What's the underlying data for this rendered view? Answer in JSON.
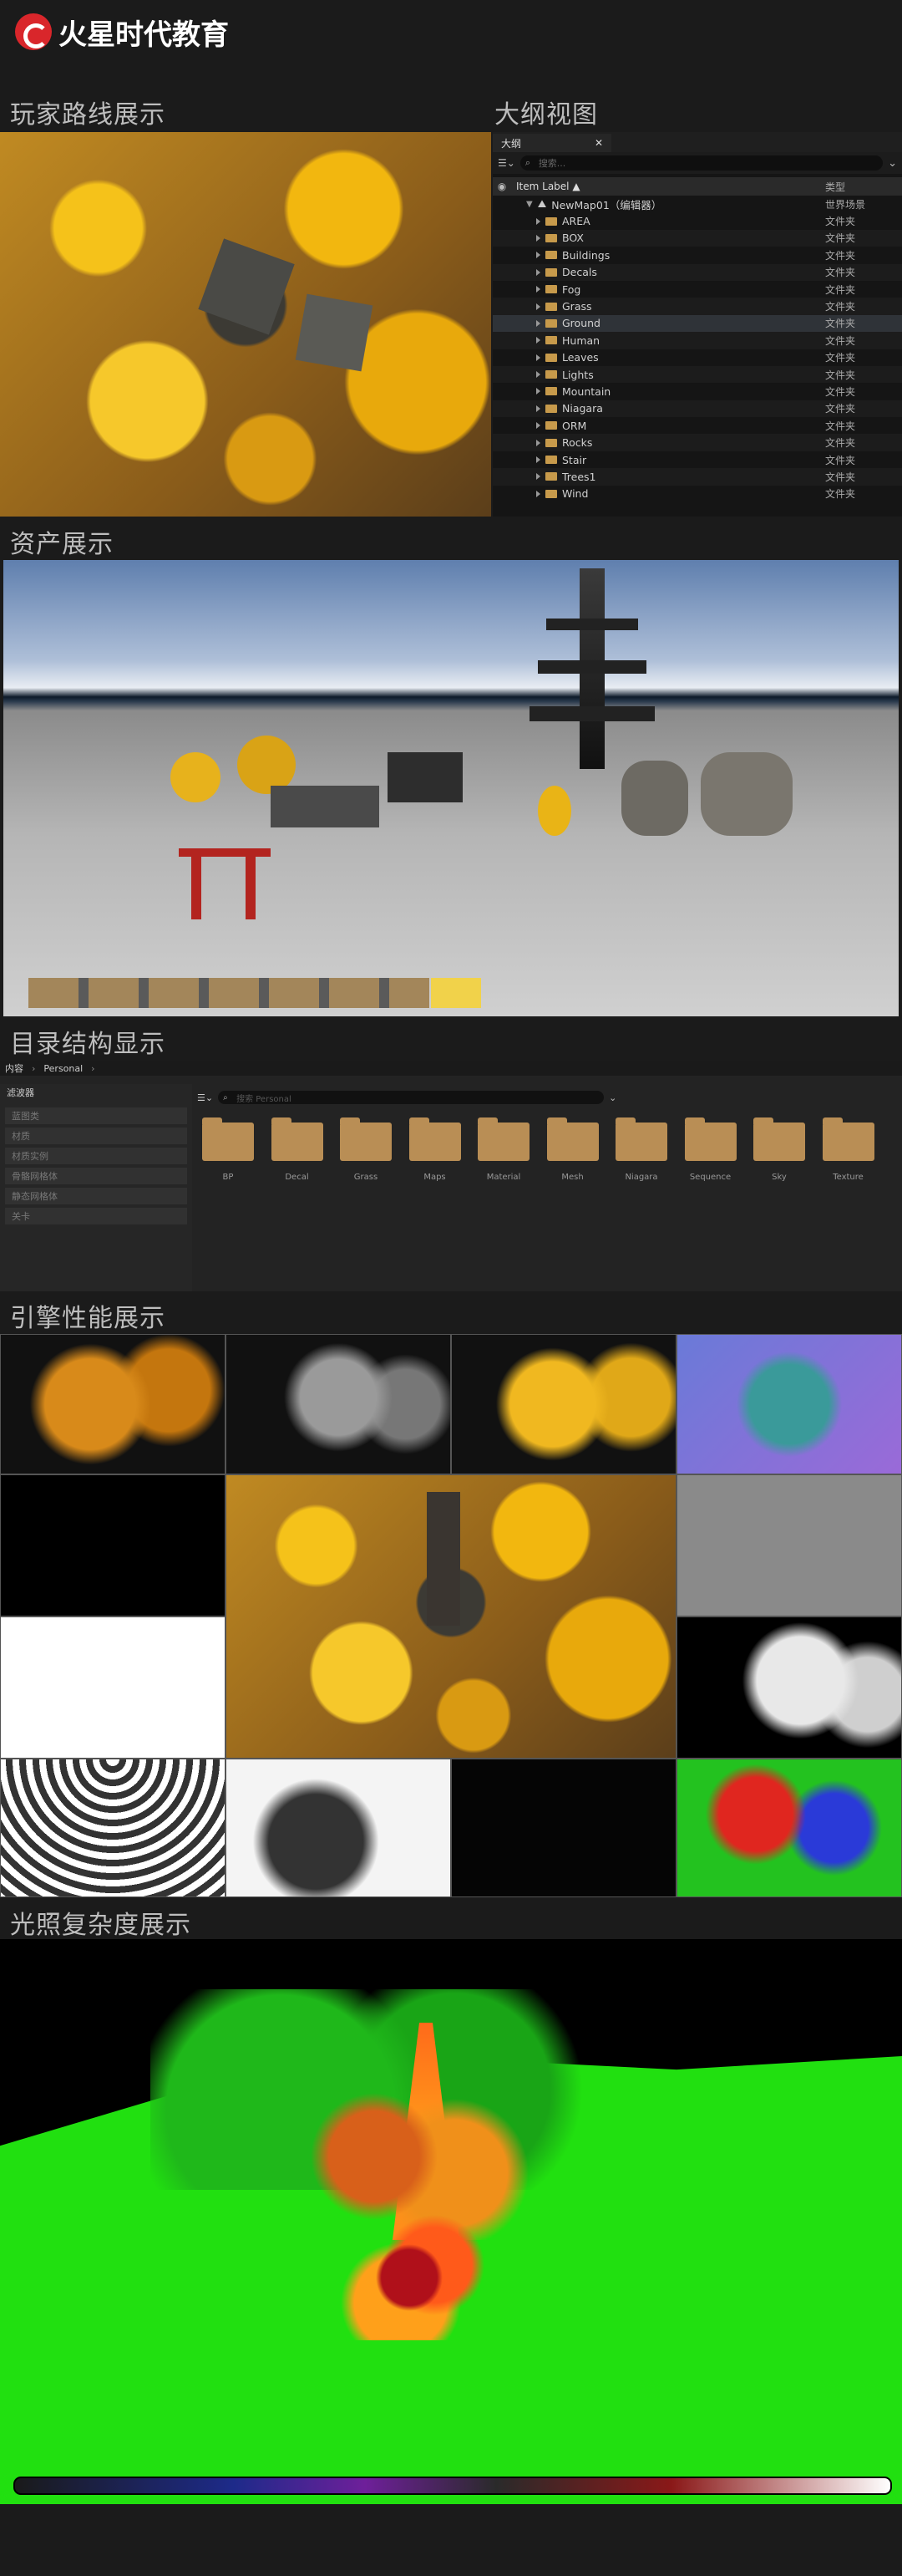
{
  "brand": {
    "name": "火星时代教育",
    "accent": "#d9262b"
  },
  "sections": {
    "route": "玩家路线展示",
    "outline": "大纲视图",
    "assets": "资产展示",
    "directory": "目录结构显示",
    "engine": "引擎性能展示",
    "lighting": "光照复杂度展示"
  },
  "outliner": {
    "tab_label": "大纲",
    "search_placeholder": "搜索...",
    "col_label": "Item Label ▲",
    "col_type": "类型",
    "root": {
      "label": "NewMap01（编辑器）",
      "type": "世界场景"
    },
    "items": [
      {
        "label": "AREA",
        "type": "文件夹"
      },
      {
        "label": "BOX",
        "type": "文件夹"
      },
      {
        "label": "Buildings",
        "type": "文件夹"
      },
      {
        "label": "Decals",
        "type": "文件夹"
      },
      {
        "label": "Fog",
        "type": "文件夹"
      },
      {
        "label": "Grass",
        "type": "文件夹"
      },
      {
        "label": "Ground",
        "type": "文件夹"
      },
      {
        "label": "Human",
        "type": "文件夹"
      },
      {
        "label": "Leaves",
        "type": "文件夹"
      },
      {
        "label": "Lights",
        "type": "文件夹"
      },
      {
        "label": "Mountain",
        "type": "文件夹"
      },
      {
        "label": "Niagara",
        "type": "文件夹"
      },
      {
        "label": "ORM",
        "type": "文件夹"
      },
      {
        "label": "Rocks",
        "type": "文件夹"
      },
      {
        "label": "Stair",
        "type": "文件夹"
      },
      {
        "label": "Trees1",
        "type": "文件夹"
      },
      {
        "label": "Wind",
        "type": "文件夹"
      }
    ]
  },
  "content_browser": {
    "path": [
      "内容",
      "Personal"
    ],
    "filters_title": "滤波器",
    "filters": [
      "蓝图类",
      "材质",
      "材质实例",
      "骨骼网格体",
      "静态网格体",
      "关卡"
    ],
    "search_placeholder": "搜索 Personal",
    "folders": [
      "BP",
      "Decal",
      "Grass",
      "Maps",
      "Material",
      "Mesh",
      "Niagara",
      "Sequence",
      "Sky",
      "Texture"
    ]
  }
}
